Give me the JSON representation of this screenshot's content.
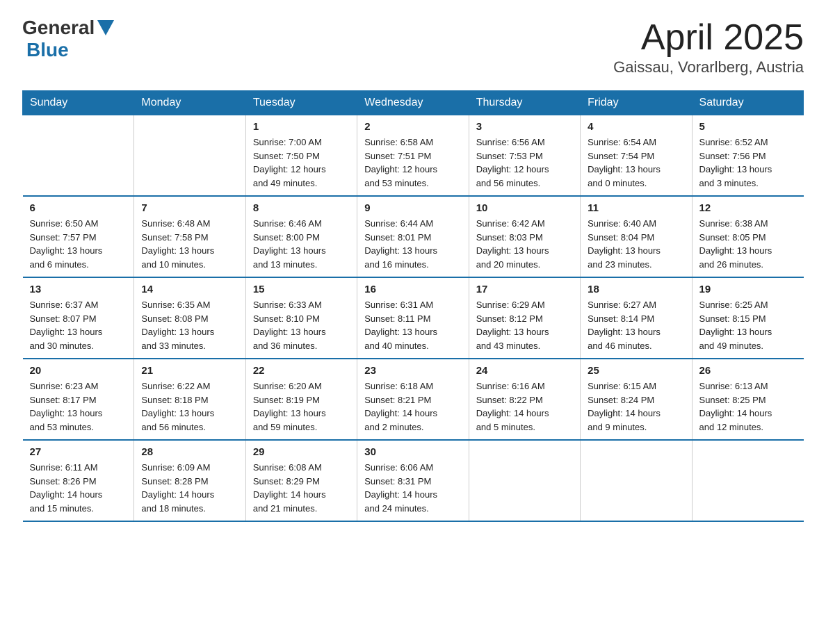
{
  "logo": {
    "general": "General",
    "blue": "Blue"
  },
  "title": "April 2025",
  "subtitle": "Gaissau, Vorarlberg, Austria",
  "weekdays": [
    "Sunday",
    "Monday",
    "Tuesday",
    "Wednesday",
    "Thursday",
    "Friday",
    "Saturday"
  ],
  "weeks": [
    [
      {
        "num": "",
        "info": ""
      },
      {
        "num": "",
        "info": ""
      },
      {
        "num": "1",
        "info": "Sunrise: 7:00 AM\nSunset: 7:50 PM\nDaylight: 12 hours\nand 49 minutes."
      },
      {
        "num": "2",
        "info": "Sunrise: 6:58 AM\nSunset: 7:51 PM\nDaylight: 12 hours\nand 53 minutes."
      },
      {
        "num": "3",
        "info": "Sunrise: 6:56 AM\nSunset: 7:53 PM\nDaylight: 12 hours\nand 56 minutes."
      },
      {
        "num": "4",
        "info": "Sunrise: 6:54 AM\nSunset: 7:54 PM\nDaylight: 13 hours\nand 0 minutes."
      },
      {
        "num": "5",
        "info": "Sunrise: 6:52 AM\nSunset: 7:56 PM\nDaylight: 13 hours\nand 3 minutes."
      }
    ],
    [
      {
        "num": "6",
        "info": "Sunrise: 6:50 AM\nSunset: 7:57 PM\nDaylight: 13 hours\nand 6 minutes."
      },
      {
        "num": "7",
        "info": "Sunrise: 6:48 AM\nSunset: 7:58 PM\nDaylight: 13 hours\nand 10 minutes."
      },
      {
        "num": "8",
        "info": "Sunrise: 6:46 AM\nSunset: 8:00 PM\nDaylight: 13 hours\nand 13 minutes."
      },
      {
        "num": "9",
        "info": "Sunrise: 6:44 AM\nSunset: 8:01 PM\nDaylight: 13 hours\nand 16 minutes."
      },
      {
        "num": "10",
        "info": "Sunrise: 6:42 AM\nSunset: 8:03 PM\nDaylight: 13 hours\nand 20 minutes."
      },
      {
        "num": "11",
        "info": "Sunrise: 6:40 AM\nSunset: 8:04 PM\nDaylight: 13 hours\nand 23 minutes."
      },
      {
        "num": "12",
        "info": "Sunrise: 6:38 AM\nSunset: 8:05 PM\nDaylight: 13 hours\nand 26 minutes."
      }
    ],
    [
      {
        "num": "13",
        "info": "Sunrise: 6:37 AM\nSunset: 8:07 PM\nDaylight: 13 hours\nand 30 minutes."
      },
      {
        "num": "14",
        "info": "Sunrise: 6:35 AM\nSunset: 8:08 PM\nDaylight: 13 hours\nand 33 minutes."
      },
      {
        "num": "15",
        "info": "Sunrise: 6:33 AM\nSunset: 8:10 PM\nDaylight: 13 hours\nand 36 minutes."
      },
      {
        "num": "16",
        "info": "Sunrise: 6:31 AM\nSunset: 8:11 PM\nDaylight: 13 hours\nand 40 minutes."
      },
      {
        "num": "17",
        "info": "Sunrise: 6:29 AM\nSunset: 8:12 PM\nDaylight: 13 hours\nand 43 minutes."
      },
      {
        "num": "18",
        "info": "Sunrise: 6:27 AM\nSunset: 8:14 PM\nDaylight: 13 hours\nand 46 minutes."
      },
      {
        "num": "19",
        "info": "Sunrise: 6:25 AM\nSunset: 8:15 PM\nDaylight: 13 hours\nand 49 minutes."
      }
    ],
    [
      {
        "num": "20",
        "info": "Sunrise: 6:23 AM\nSunset: 8:17 PM\nDaylight: 13 hours\nand 53 minutes."
      },
      {
        "num": "21",
        "info": "Sunrise: 6:22 AM\nSunset: 8:18 PM\nDaylight: 13 hours\nand 56 minutes."
      },
      {
        "num": "22",
        "info": "Sunrise: 6:20 AM\nSunset: 8:19 PM\nDaylight: 13 hours\nand 59 minutes."
      },
      {
        "num": "23",
        "info": "Sunrise: 6:18 AM\nSunset: 8:21 PM\nDaylight: 14 hours\nand 2 minutes."
      },
      {
        "num": "24",
        "info": "Sunrise: 6:16 AM\nSunset: 8:22 PM\nDaylight: 14 hours\nand 5 minutes."
      },
      {
        "num": "25",
        "info": "Sunrise: 6:15 AM\nSunset: 8:24 PM\nDaylight: 14 hours\nand 9 minutes."
      },
      {
        "num": "26",
        "info": "Sunrise: 6:13 AM\nSunset: 8:25 PM\nDaylight: 14 hours\nand 12 minutes."
      }
    ],
    [
      {
        "num": "27",
        "info": "Sunrise: 6:11 AM\nSunset: 8:26 PM\nDaylight: 14 hours\nand 15 minutes."
      },
      {
        "num": "28",
        "info": "Sunrise: 6:09 AM\nSunset: 8:28 PM\nDaylight: 14 hours\nand 18 minutes."
      },
      {
        "num": "29",
        "info": "Sunrise: 6:08 AM\nSunset: 8:29 PM\nDaylight: 14 hours\nand 21 minutes."
      },
      {
        "num": "30",
        "info": "Sunrise: 6:06 AM\nSunset: 8:31 PM\nDaylight: 14 hours\nand 24 minutes."
      },
      {
        "num": "",
        "info": ""
      },
      {
        "num": "",
        "info": ""
      },
      {
        "num": "",
        "info": ""
      }
    ]
  ]
}
